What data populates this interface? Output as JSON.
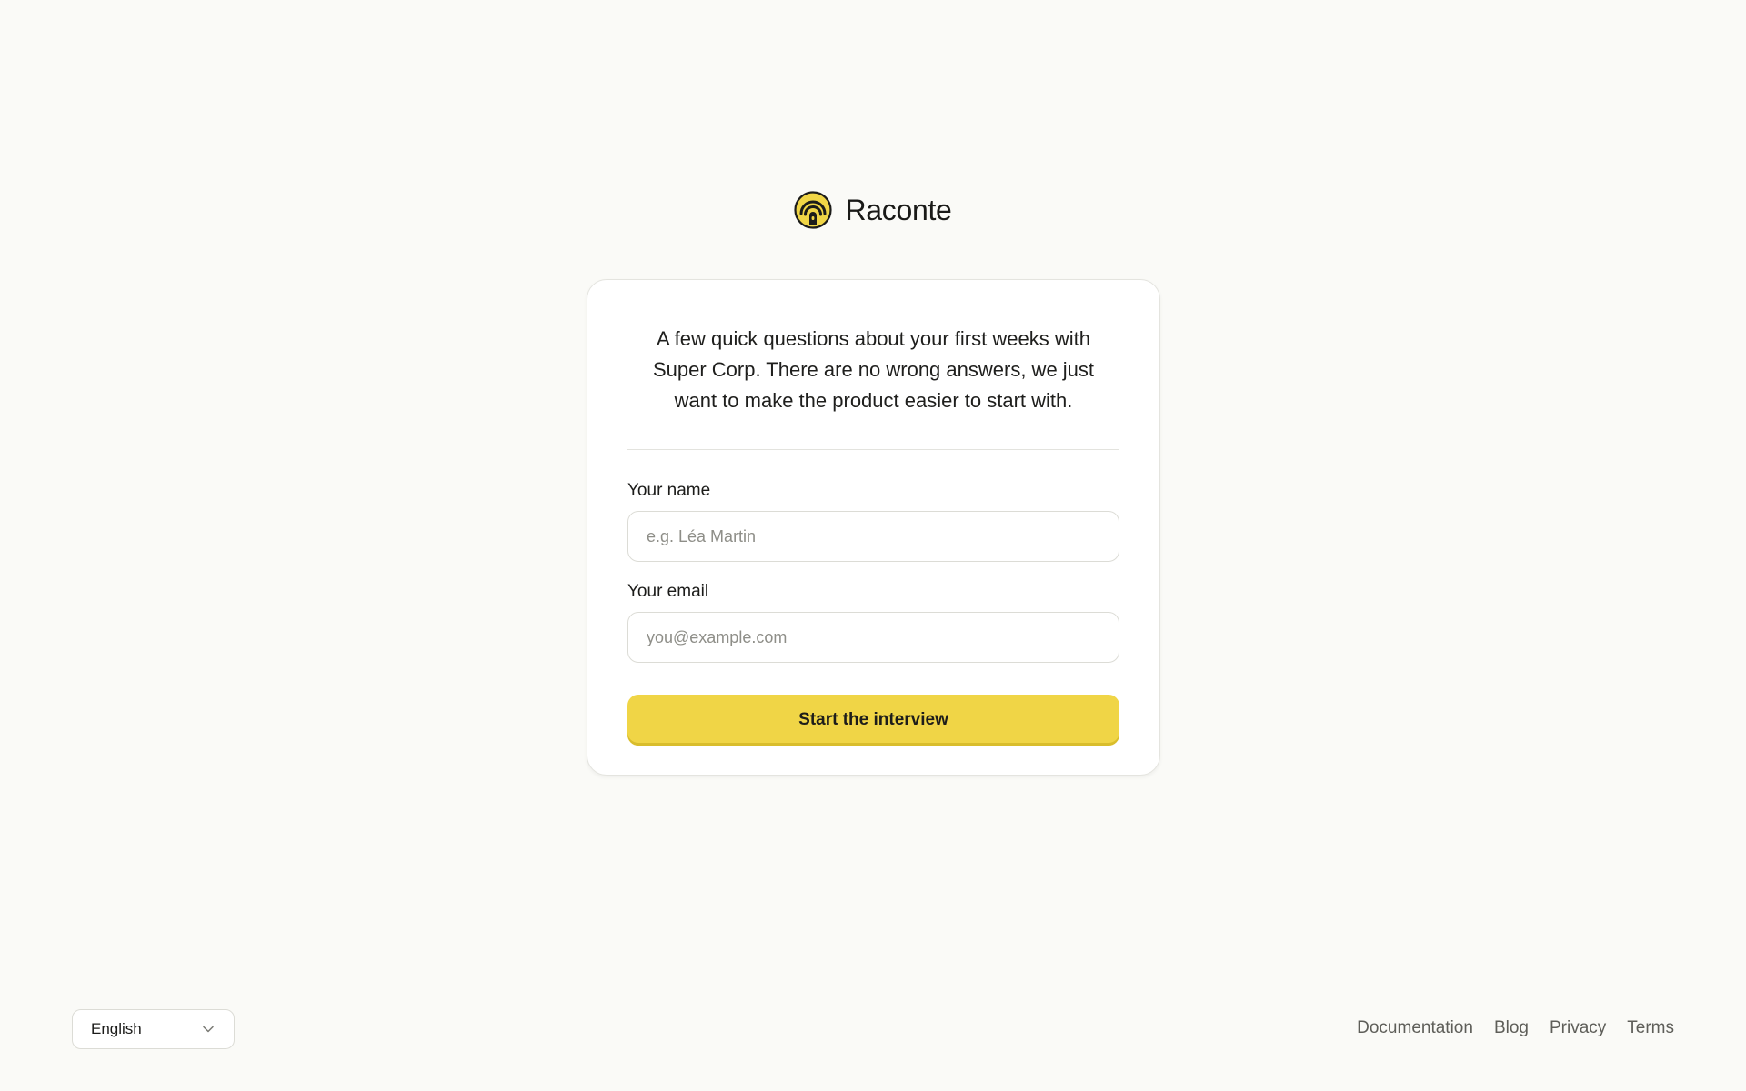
{
  "brand": {
    "name": "Raconte",
    "logo_icon": "raconte-logo-icon",
    "accent_color": "#f0d546"
  },
  "card": {
    "intro": "A few quick questions about your first weeks with Super Corp. There are no wrong answers, we just want to make the product easier to start with.",
    "name_field": {
      "label": "Your name",
      "placeholder": "e.g. Léa Martin",
      "value": ""
    },
    "email_field": {
      "label": "Your email",
      "placeholder": "you@example.com",
      "value": ""
    },
    "submit_label": "Start the interview"
  },
  "footer": {
    "language": {
      "selected": "English",
      "icon": "chevron-down-icon"
    },
    "links": [
      "Documentation",
      "Blog",
      "Privacy",
      "Terms"
    ]
  }
}
